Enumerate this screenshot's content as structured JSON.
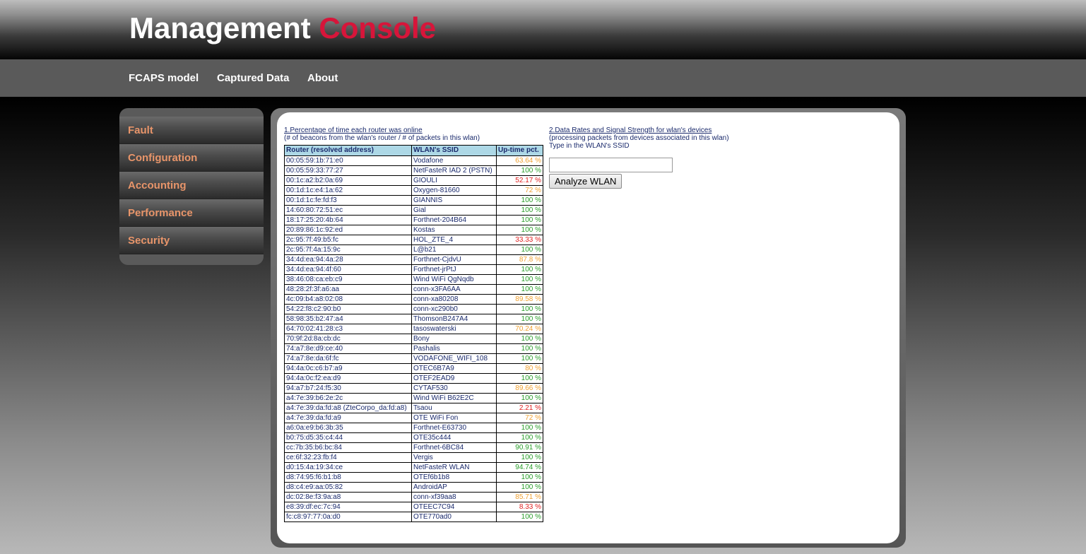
{
  "brand": {
    "word1": "Management",
    "word2": "Console"
  },
  "topnav": [
    "FCAPS model",
    "Captured Data",
    "About"
  ],
  "sidebar": [
    "Fault",
    "Configuration",
    "Accounting",
    "Performance",
    "Security"
  ],
  "section1": {
    "title": "1.Percentage of time each router was online",
    "subtitle": "(# of beacons from the wlan's router / # of packets in this wlan)",
    "headers": [
      "Router (resolved address)",
      "WLAN's SSID",
      "Up-time pct."
    ],
    "rows": [
      {
        "router": "00:05:59:1b:71:e0",
        "ssid": "Vodafone",
        "pct": "63.64 %",
        "level": "orange"
      },
      {
        "router": "00:05:59:33:77:27",
        "ssid": "NetFasteR IAD 2 (PSTN)",
        "pct": "100 %",
        "level": "green"
      },
      {
        "router": "00:1c:a2:b2:0a:69",
        "ssid": "GIOULI",
        "pct": "52.17 %",
        "level": "red"
      },
      {
        "router": "00:1d:1c:e4:1a:62",
        "ssid": "Oxygen-81660",
        "pct": "72 %",
        "level": "orange"
      },
      {
        "router": "00:1d:1c:fe:fd:f3",
        "ssid": "GIANNIS",
        "pct": "100 %",
        "level": "green"
      },
      {
        "router": "14:60:80:72:51:ec",
        "ssid": "Gial",
        "pct": "100 %",
        "level": "green"
      },
      {
        "router": "18:17:25:20:4b:64",
        "ssid": "Forthnet-204B64",
        "pct": "100 %",
        "level": "green"
      },
      {
        "router": "20:89:86:1c:92:ed",
        "ssid": "Kostas",
        "pct": "100 %",
        "level": "green"
      },
      {
        "router": "2c:95:7f:49:b5:fc",
        "ssid": "HOL_ZTE_4",
        "pct": "33.33 %",
        "level": "red"
      },
      {
        "router": "2c:95:7f:4a:15:9c",
        "ssid": "L@b21",
        "pct": "100 %",
        "level": "green"
      },
      {
        "router": "34:4d:ea:94:4a:28",
        "ssid": "Forthnet-CjdvU",
        "pct": "87.8 %",
        "level": "orange"
      },
      {
        "router": "34:4d:ea:94:4f:60",
        "ssid": "Forthnet-jrPtJ",
        "pct": "100 %",
        "level": "green"
      },
      {
        "router": "38:46:08:ca:eb:c9",
        "ssid": "Wind WiFi QgNqdb",
        "pct": "100 %",
        "level": "green"
      },
      {
        "router": "48:28:2f:3f:a6:aa",
        "ssid": "conn-x3FA6AA",
        "pct": "100 %",
        "level": "green"
      },
      {
        "router": "4c:09:b4:a8:02:08",
        "ssid": "conn-xa80208",
        "pct": "89.58 %",
        "level": "orange"
      },
      {
        "router": "54:22:f8:c2:90:b0",
        "ssid": "conn-xc290b0",
        "pct": "100 %",
        "level": "green"
      },
      {
        "router": "58:98:35:b2:47:a4",
        "ssid": "ThomsonB247A4",
        "pct": "100 %",
        "level": "green"
      },
      {
        "router": "64:70:02:41:28:c3",
        "ssid": "tasoswaterski",
        "pct": "70.24 %",
        "level": "orange"
      },
      {
        "router": "70:9f:2d:8a:cb:dc",
        "ssid": "Bony",
        "pct": "100 %",
        "level": "green"
      },
      {
        "router": "74:a7:8e:d9:ce:40",
        "ssid": "Pashalis",
        "pct": "100 %",
        "level": "green"
      },
      {
        "router": "74:a7:8e:da:6f:fc",
        "ssid": "VODAFONE_WIFI_108",
        "pct": "100 %",
        "level": "green"
      },
      {
        "router": "94:4a:0c:c6:b7:a9",
        "ssid": "OTEC6B7A9",
        "pct": "80 %",
        "level": "orange"
      },
      {
        "router": "94:4a:0c:f2:ea:d9",
        "ssid": "OTEF2EAD9",
        "pct": "100 %",
        "level": "green"
      },
      {
        "router": "94:a7:b7:24:f5:30",
        "ssid": "CYTAF530",
        "pct": "89.66 %",
        "level": "orange"
      },
      {
        "router": "a4:7e:39:b6:2e:2c",
        "ssid": "Wind WiFi B62E2C",
        "pct": "100 %",
        "level": "green"
      },
      {
        "router": "a4:7e:39:da:fd:a8 (ZteCorpo_da:fd:a8)",
        "ssid": "Tsaou",
        "pct": "2.21 %",
        "level": "red"
      },
      {
        "router": "a4:7e:39:da:fd:a9",
        "ssid": "OTE WiFi Fon",
        "pct": "72 %",
        "level": "orange"
      },
      {
        "router": "a6:0a:e9:b6:3b:35",
        "ssid": "Forthnet-E63730",
        "pct": "100 %",
        "level": "green"
      },
      {
        "router": "b0:75:d5:35:c4:44",
        "ssid": "OTE35c444",
        "pct": "100 %",
        "level": "green"
      },
      {
        "router": "cc:7b:35:b6:bc:84",
        "ssid": "Forthnet-6BC84",
        "pct": "90.91 %",
        "level": "green"
      },
      {
        "router": "ce:6f:32:23:fb:f4",
        "ssid": "Vergis",
        "pct": "100 %",
        "level": "green"
      },
      {
        "router": "d0:15:4a:19:34:ce",
        "ssid": "NetFasteR WLAN",
        "pct": "94.74 %",
        "level": "green"
      },
      {
        "router": "d8:74:95:f6:b1:b8",
        "ssid": "OTEf6b1b8",
        "pct": "100 %",
        "level": "green"
      },
      {
        "router": "d8:c4:e9:aa:05:82",
        "ssid": "AndroidAP",
        "pct": "100 %",
        "level": "green"
      },
      {
        "router": "dc:02:8e:f3:9a:a8",
        "ssid": "conn-xf39aa8",
        "pct": "85.71 %",
        "level": "orange"
      },
      {
        "router": "e8:39:df:ec:7c:94",
        "ssid": "OTEEC7C94",
        "pct": "8.33 %",
        "level": "red"
      },
      {
        "router": "fc:c8:97:77:0a:d0",
        "ssid": "OTE770ad0",
        "pct": "100 %",
        "level": "green"
      }
    ]
  },
  "section2": {
    "title": "2.Data Rates and Signal Strength for wlan's devices",
    "subtitle": "(processing packets from devices associated in this wlan)",
    "instruction": "Type in the WLAN's SSID",
    "input_value": "",
    "button_label": "Analyze WLAN"
  },
  "colors": {
    "brand_accent": "#d7153a",
    "sidebar_text": "#e8956a",
    "status_green": "#2a9d2a",
    "status_orange": "#f0a030",
    "status_red": "#e02020",
    "table_header_bg": "#add8e6"
  }
}
